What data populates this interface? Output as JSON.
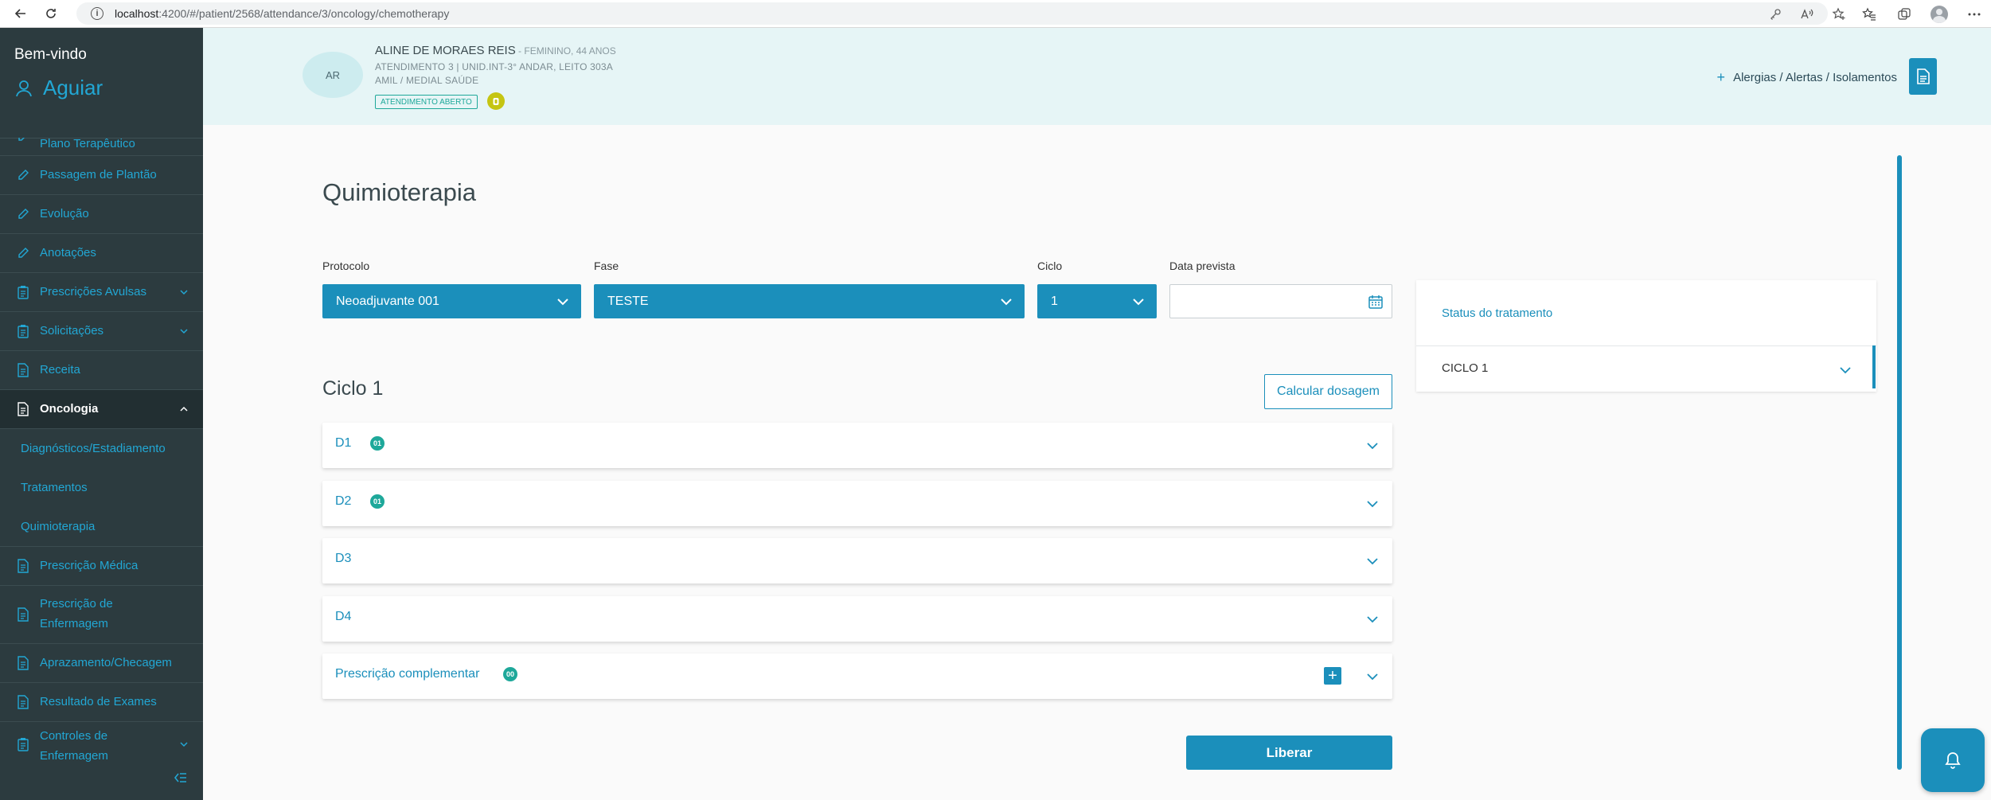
{
  "browser": {
    "url_host": "localhost",
    "url_path": ":4200/#/patient/2568/attendance/3/oncology/chemotherapy"
  },
  "sidebar": {
    "welcome": "Bem-vindo",
    "user_name": "Aguiar",
    "items": [
      {
        "label": "Plano Terapêutico",
        "icon": "pencil-icon"
      },
      {
        "label": "Passagem de Plantão",
        "icon": "pencil-icon"
      },
      {
        "label": "Evolução",
        "icon": "pencil-icon"
      },
      {
        "label": "Anotações",
        "icon": "pencil-icon"
      },
      {
        "label": "Prescrições Avulsas",
        "icon": "clipboard-icon"
      },
      {
        "label": "Solicitações",
        "icon": "clipboard-icon"
      },
      {
        "label": "Receita",
        "icon": "document-icon"
      },
      {
        "label": "Oncologia",
        "icon": "document-icon"
      },
      {
        "label": "Diagnósticos/Estadiamento"
      },
      {
        "label": "Tratamentos"
      },
      {
        "label": "Quimioterapia"
      },
      {
        "label": "Prescrição Médica",
        "icon": "document-icon"
      },
      {
        "label_line1": "Prescrição de",
        "label_line2": "Enfermagem",
        "icon": "document-icon"
      },
      {
        "label": "Aprazamento/Checagem",
        "icon": "document-icon"
      },
      {
        "label": "Resultado de Exames",
        "icon": "document-icon"
      },
      {
        "label_line1": "Controles de",
        "label_line2": "Enfermagem",
        "icon": "clipboard-icon"
      }
    ]
  },
  "patient": {
    "initials": "AR",
    "name": "ALINE DE MORAES REIS",
    "gender_age": " - FEMININO, 44 ANOS",
    "attendance": "ATENDIMENTO 3 | UNID.INT-3° ANDAR, LEITO 303A",
    "insurance": "AMIL / MEDIAL SAÚDE",
    "badge": "ATENDIMENTO ABERTO",
    "alerts_link": "Alergias / Alertas / Isolamentos"
  },
  "main": {
    "title": "Quimioterapia",
    "fields": {
      "protocolo_label": "Protocolo",
      "protocolo_value": "Neoadjuvante 001",
      "fase_label": "Fase",
      "fase_value": "TESTE",
      "ciclo_label": "Ciclo",
      "ciclo_value": "1",
      "data_label": "Data prevista",
      "data_value": ""
    },
    "cycle_title": "Ciclo 1",
    "calc_button": "Calcular dosagem",
    "accordions": [
      {
        "label": "D1",
        "count": "01"
      },
      {
        "label": "D2",
        "count": "01"
      },
      {
        "label": "D3",
        "count": ""
      },
      {
        "label": "D4",
        "count": ""
      },
      {
        "label": "Prescrição complementar",
        "count": "00"
      }
    ],
    "release_button": "Liberar"
  },
  "status_panel": {
    "title": "Status do tratamento",
    "cycle": "CICLO 1"
  },
  "colors": {
    "primary": "#1b8fbb",
    "sidebar_bg": "#2c3b3f",
    "header_bg": "#e6f5f6",
    "badge_green": "#1ea89a"
  }
}
